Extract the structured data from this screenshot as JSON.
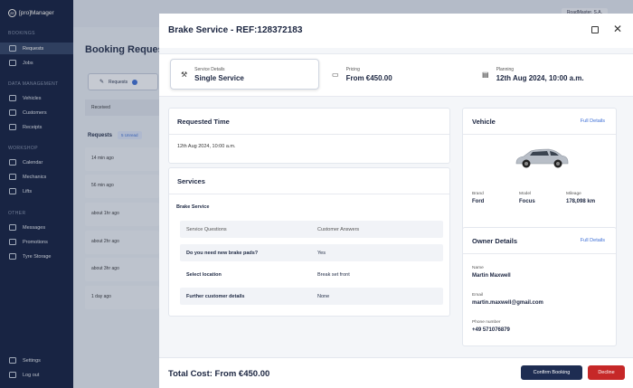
{
  "app": {
    "brand": "[pro]Manager"
  },
  "sidebar": {
    "sections": [
      "BOOKINGS",
      "DATA MANAGEMENT",
      "WORKSHOP",
      "OTHER"
    ],
    "items": [
      {
        "label": "Requests"
      },
      {
        "label": "Jobs"
      },
      {
        "label": "Vehicles"
      },
      {
        "label": "Customers"
      },
      {
        "label": "Receipts"
      },
      {
        "label": "Calendar"
      },
      {
        "label": "Mechanics"
      },
      {
        "label": "Lifts"
      },
      {
        "label": "Messages"
      },
      {
        "label": "Promotions"
      },
      {
        "label": "Tyre Storage"
      },
      {
        "label": "Settings"
      },
      {
        "label": "Log out"
      }
    ]
  },
  "background": {
    "user_chip": "RoadMaster, S.A.",
    "page_title": "Booking Requests",
    "requests_button": "Requests",
    "received_filter": "Received",
    "requests_heading": "Requests",
    "unread_badge": "5 Unread",
    "rows": [
      "14 min ago",
      "56 min ago",
      "about 1hr ago",
      "about 2hr ago",
      "about 3hr ago",
      "1 day ago"
    ]
  },
  "modal": {
    "title": "Brake Service - REF:128372183",
    "tabs": [
      {
        "small": "Service Details",
        "big": "Single Service",
        "icon": "tools-icon"
      },
      {
        "small": "Pricing",
        "big": "From €450.00",
        "icon": "money-icon"
      },
      {
        "small": "Planning",
        "big": "12th Aug 2024, 10:00 a.m.",
        "icon": "calendar-icon"
      }
    ],
    "requested_time": {
      "heading": "Requested Time",
      "value": "12th Aug 2024, 10:00 a.m."
    },
    "services": {
      "heading": "Services",
      "service_name": "Brake Service",
      "col_question": "Service Questions",
      "col_answer": "Customer Answers",
      "rows": [
        {
          "q": "Do you need new brake pads?",
          "a": "Yes"
        },
        {
          "q": "Select location",
          "a": "Break set front"
        },
        {
          "q": "Further customer details",
          "a": "None"
        }
      ]
    },
    "vehicle": {
      "heading": "Vehicle",
      "link": "Full Details",
      "brand_label": "Brand",
      "brand": "Ford",
      "model_label": "Model",
      "model": "Focus",
      "mileage_label": "Mileage",
      "mileage": "178,098 km"
    },
    "owner": {
      "heading": "Owner Details",
      "link": "Full Details",
      "name_label": "Name",
      "name": "Martin Maxwell",
      "email_label": "Email",
      "email": "martin.maxwell@gmail.com",
      "phone_label": "Phone number",
      "phone": "+49 571076879"
    },
    "footer": {
      "total": "Total Cost: From €450.00",
      "confirm": "Confirm Booking",
      "decline": "Decline"
    },
    "colors": {
      "primary": "#1e2d52",
      "danger": "#c62828",
      "link": "#3d6fd6"
    }
  }
}
